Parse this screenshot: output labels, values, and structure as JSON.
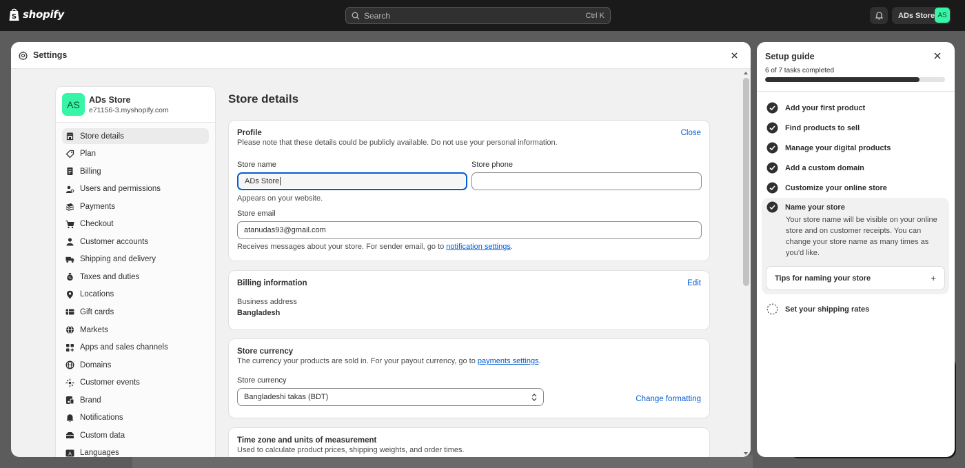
{
  "topbar": {
    "logo_text": "shopify",
    "search_placeholder": "Search",
    "search_shortcut": "Ctrl K",
    "store_name": "ADs Store",
    "store_initials": "AS"
  },
  "settings": {
    "title": "Settings",
    "store": {
      "initials": "AS",
      "name": "ADs Store",
      "url": "e71156-3.myshopify.com"
    },
    "nav": [
      {
        "label": "Store details",
        "icon": "store-icon",
        "active": true
      },
      {
        "label": "Plan",
        "icon": "plan-icon"
      },
      {
        "label": "Billing",
        "icon": "billing-icon"
      },
      {
        "label": "Users and permissions",
        "icon": "users-icon"
      },
      {
        "label": "Payments",
        "icon": "payments-icon"
      },
      {
        "label": "Checkout",
        "icon": "cart-icon"
      },
      {
        "label": "Customer accounts",
        "icon": "person-icon"
      },
      {
        "label": "Shipping and delivery",
        "icon": "truck-icon"
      },
      {
        "label": "Taxes and duties",
        "icon": "tax-icon"
      },
      {
        "label": "Locations",
        "icon": "location-icon"
      },
      {
        "label": "Gift cards",
        "icon": "gift-card-icon"
      },
      {
        "label": "Markets",
        "icon": "globe-icon"
      },
      {
        "label": "Apps and sales channels",
        "icon": "apps-icon"
      },
      {
        "label": "Domains",
        "icon": "domain-icon"
      },
      {
        "label": "Customer events",
        "icon": "events-icon"
      },
      {
        "label": "Brand",
        "icon": "brand-icon"
      },
      {
        "label": "Notifications",
        "icon": "bell-icon"
      },
      {
        "label": "Custom data",
        "icon": "data-icon"
      },
      {
        "label": "Languages",
        "icon": "language-icon"
      }
    ]
  },
  "main": {
    "title": "Store details",
    "profile": {
      "title": "Profile",
      "subtitle": "Please note that these details could be publicly available. Do not use your personal information.",
      "close_label": "Close",
      "store_name_label": "Store name",
      "store_name_value": "ADs Store",
      "store_name_help": "Appears on your website.",
      "store_phone_label": "Store phone",
      "store_phone_value": "",
      "store_email_label": "Store email",
      "store_email_value": "atanudas93@gmail.com",
      "email_help_prefix": "Receives messages about your store. For sender email, go to ",
      "email_help_link": "notification settings",
      "email_help_suffix": "."
    },
    "billing": {
      "title": "Billing information",
      "edit_label": "Edit",
      "address_label": "Business address",
      "address_value": "Bangladesh"
    },
    "currency": {
      "title": "Store currency",
      "subtitle_prefix": "The currency your products are sold in. For your payout currency, go to ",
      "subtitle_link": "payments settings",
      "subtitle_suffix": ".",
      "field_label": "Store currency",
      "selected": "Bangladeshi takas (BDT)",
      "change_label": "Change formatting"
    },
    "timezone": {
      "title": "Time zone and units of measurement",
      "subtitle": "Used to calculate product prices, shipping weights, and order times."
    }
  },
  "guide": {
    "title": "Setup guide",
    "progress_text": "6 of 7 tasks completed",
    "progress_fraction": 0.857,
    "tasks": [
      {
        "label": "Add your first product",
        "done": true
      },
      {
        "label": "Find products to sell",
        "done": true
      },
      {
        "label": "Manage your digital products",
        "done": true
      },
      {
        "label": "Add a custom domain",
        "done": true
      },
      {
        "label": "Customize your online store",
        "done": true
      },
      {
        "label": "Name your store",
        "done": true
      },
      {
        "label": "Set your shipping rates",
        "done": false
      }
    ],
    "expanded_description": "Your store name will be visible on your online store and on customer receipts. You can change your store name as many times as you’d like.",
    "tips_label": "Tips for naming your store",
    "tips_icon": "+"
  },
  "colors": {
    "accent": "#005bd3",
    "avatar": "#36f5a5",
    "topbar": "#1a1a1a"
  }
}
